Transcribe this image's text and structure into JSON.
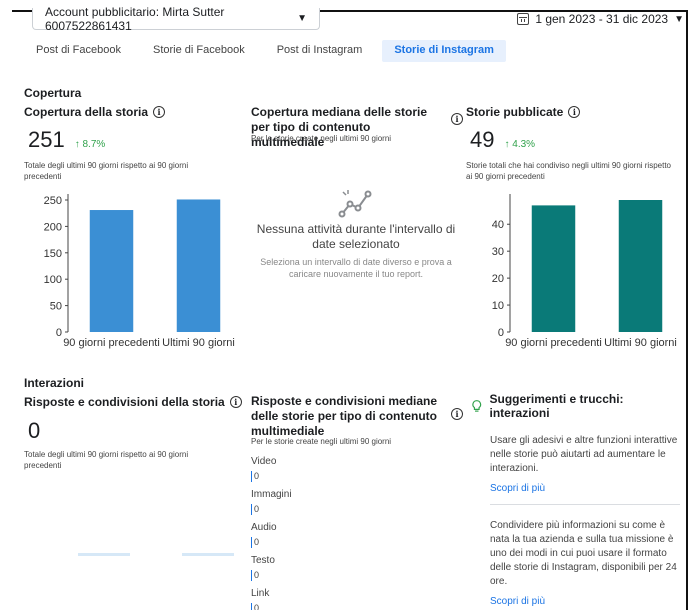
{
  "header": {
    "account_label": "Account pubblicitario: Mirta Sutter 6007522861431",
    "date_range": "1 gen 2023 - 31 dic 2023"
  },
  "tabs": [
    {
      "label": "Post di Facebook",
      "active": false
    },
    {
      "label": "Storie di Facebook",
      "active": false
    },
    {
      "label": "Post di Instagram",
      "active": false
    },
    {
      "label": "Storie di Instagram",
      "active": true
    }
  ],
  "coverage": {
    "section_title": "Copertura",
    "story_reach": {
      "title": "Copertura della storia",
      "value": "251",
      "delta": "↑ 8.7%",
      "subtitle": "Totale degli ultimi 90 giorni rispetto ai 90 giorni precedenti"
    },
    "median": {
      "title": "Copertura mediana delle storie per tipo di contenuto multimediale",
      "subtitle": "Per le storie create negli ultimi 90 giorni",
      "empty_title": "Nessuna attività durante l'intervallo di date selezionato",
      "empty_sub": "Seleziona un intervallo di date diverso e prova a caricare nuovamente il tuo report."
    },
    "published": {
      "title": "Storie pubblicate",
      "value": "49",
      "delta": "↑ 4.3%",
      "subtitle": "Storie totali che hai condiviso negli ultimi 90 giorni rispetto ai 90 giorni precedenti"
    }
  },
  "interactions": {
    "section_title": "Interazioni",
    "replies": {
      "title": "Risposte e condivisioni della storia",
      "value": "0",
      "subtitle": "Totale degli ultimi 90 giorni rispetto ai 90 giorni precedenti"
    },
    "median": {
      "title": "Risposte e condivisioni mediane delle storie per tipo di contenuto multimediale",
      "subtitle": "Per le storie create negli ultimi 90 giorni",
      "items": [
        {
          "label": "Video",
          "value": "0"
        },
        {
          "label": "Immagini",
          "value": "0"
        },
        {
          "label": "Audio",
          "value": "0"
        },
        {
          "label": "Testo",
          "value": "0"
        },
        {
          "label": "Link",
          "value": "0"
        }
      ]
    },
    "tips": {
      "title": "Suggerimenti e trucchi: interazioni",
      "tip1": "Usare gli adesivi e altre funzioni interattive nelle storie può aiutarti ad aumentare le interazioni.",
      "tip2": "Condividere più informazioni su come è nata la tua azienda e sulla tua missione è uno dei modi in cui puoi usare il formato delle storie di Instagram, disponibili per 24 ore.",
      "link_label": "Scopri di più"
    }
  },
  "chart_data": [
    {
      "type": "bar",
      "categories": [
        "90 giorni precedenti",
        "Ultimi 90 giorni"
      ],
      "values": [
        231,
        251
      ],
      "ylim": [
        0,
        250
      ],
      "yticks": [
        0,
        50,
        100,
        150,
        200,
        250
      ],
      "color": "#3b8fd4"
    },
    {
      "type": "bar",
      "categories": [
        "90 giorni precedenti",
        "Ultimi 90 giorni"
      ],
      "values": [
        47,
        49
      ],
      "ylim": [
        0,
        49
      ],
      "yticks": [
        0,
        10,
        20,
        30,
        40
      ],
      "color": "#0a7a78"
    }
  ]
}
